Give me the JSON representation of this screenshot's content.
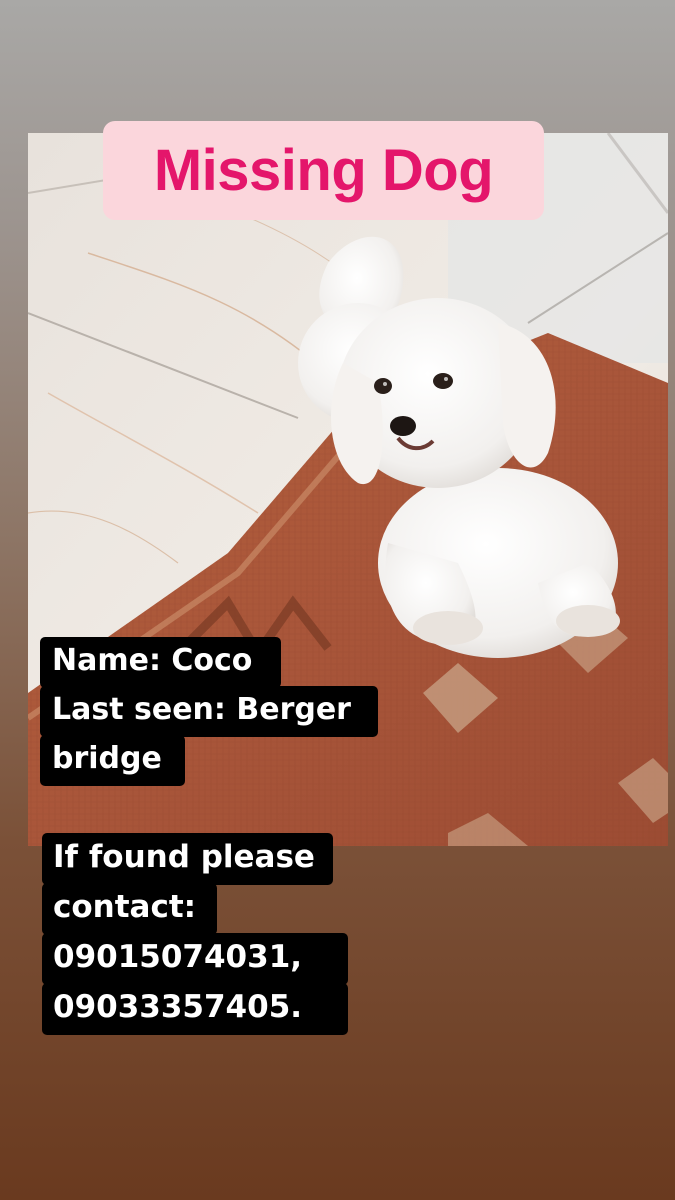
{
  "title": "Missing Dog",
  "details": {
    "name_line": "Name: Coco",
    "last_seen_line": "Last seen: Berger",
    "last_seen_cont": "bridge"
  },
  "contact": {
    "line1": "If found please",
    "line2": "contact:",
    "phone1": "09015074031,",
    "phone2": "09033357405."
  },
  "colors": {
    "title_text": "#e4166b",
    "title_bg": "#fbd6dc",
    "caption_bg": "#000000",
    "caption_text": "#ffffff"
  }
}
